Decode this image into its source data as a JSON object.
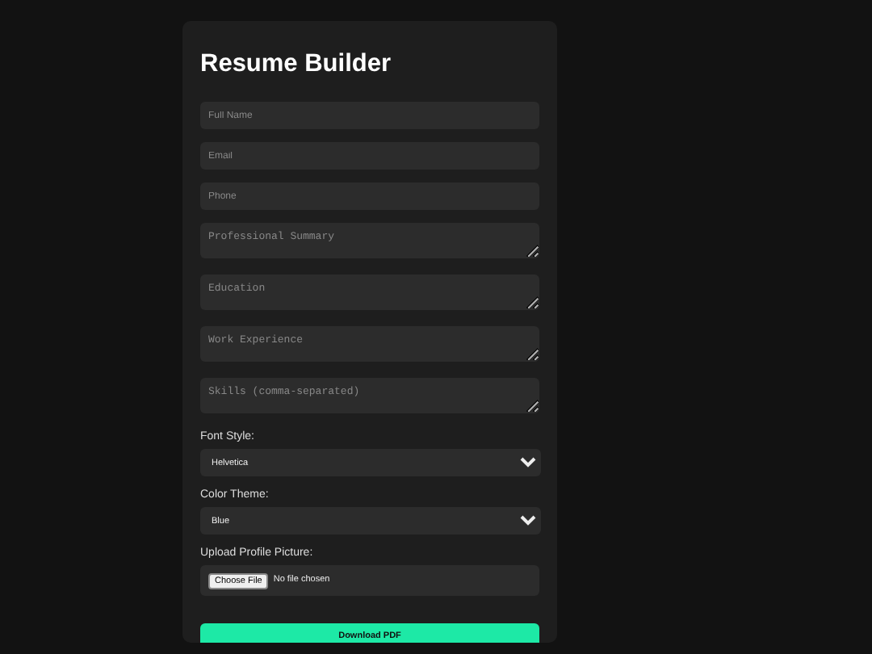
{
  "title": "Resume Builder",
  "fields": [
    {
      "kind": "input",
      "placeholder": "Full Name"
    },
    {
      "kind": "input",
      "placeholder": "Email"
    },
    {
      "kind": "input",
      "placeholder": "Phone"
    },
    {
      "kind": "textarea",
      "placeholder": "Professional Summary"
    },
    {
      "kind": "textarea",
      "placeholder": "Education"
    },
    {
      "kind": "textarea",
      "placeholder": "Work Experience"
    },
    {
      "kind": "textarea",
      "placeholder": "Skills (comma-separated)"
    }
  ],
  "selects": [
    {
      "label": "Font Style:",
      "value": "Helvetica"
    },
    {
      "label": "Color Theme:",
      "value": "Blue"
    }
  ],
  "upload": {
    "label": "Upload Profile Picture:",
    "button": "Choose File",
    "status": "No file chosen"
  },
  "submit": "Download PDF"
}
